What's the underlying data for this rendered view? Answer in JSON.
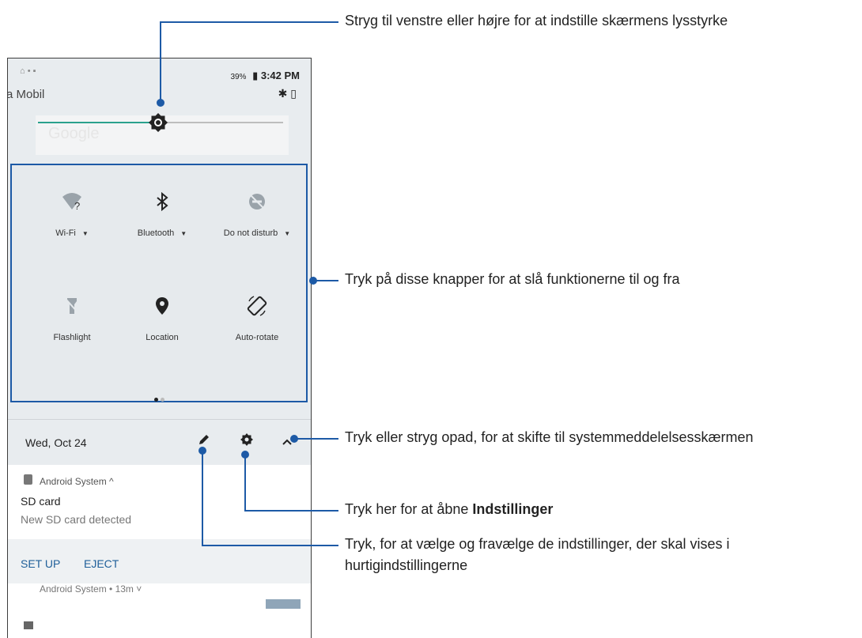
{
  "status_bar": {
    "carrier": "a Mobil",
    "battery": "39%",
    "time": "3:42 PM"
  },
  "search_ghost": "Google",
  "tiles": [
    {
      "label": "Wi-Fi",
      "icon": "wifi-unknown-icon",
      "has_menu": true
    },
    {
      "label": "Bluetooth",
      "icon": "bluetooth-icon",
      "has_menu": true
    },
    {
      "label": "Do not disturb",
      "icon": "do-not-disturb-icon",
      "has_menu": true
    },
    {
      "label": "Flashlight",
      "icon": "flashlight-off-icon",
      "has_menu": false
    },
    {
      "label": "Location",
      "icon": "location-pin-icon",
      "has_menu": false
    },
    {
      "label": "Auto-rotate",
      "icon": "auto-rotate-icon",
      "has_menu": false
    }
  ],
  "date_bar": {
    "date": "Wed, Oct 24"
  },
  "notification": {
    "app": "Android System ^",
    "title": "SD card",
    "text": "New SD card detected",
    "actions": [
      "SET UP",
      "EJECT"
    ]
  },
  "notification2": {
    "app": "Android System • 13m ˅"
  },
  "callouts": {
    "brightness": "Stryg til venstre eller højre for at indstille skærmens lysstyrke",
    "toggles": "Tryk på disse knapper for at slå funktionerne til og fra",
    "collapse": "Tryk eller stryg opad, for at skifte til systemmeddelelsesskærmen",
    "settings_prefix": "Tryk her for at åbne ",
    "settings_bold": "Indstillinger",
    "edit_line1": "Tryk, for at vælge og fravælge de indstillinger, der skal vises i",
    "edit_line2": "hurtigindstillingerne"
  },
  "colors": {
    "callout_line": "#1d5aa6",
    "accent": "#2aa18d"
  }
}
